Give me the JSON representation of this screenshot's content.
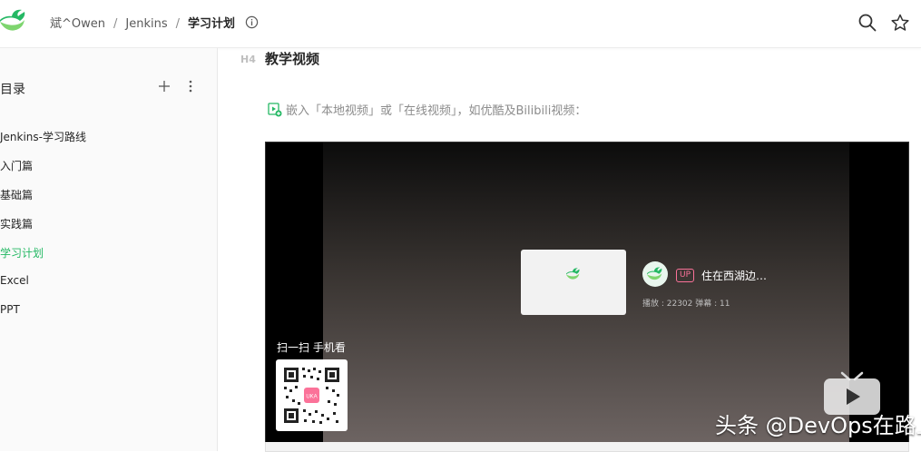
{
  "header": {
    "breadcrumb": [
      "斌^Owen",
      "Jenkins",
      "学习计划"
    ],
    "separator": "/"
  },
  "sidebar": {
    "title": "目录",
    "items": [
      {
        "label": "Jenkins-学习路线"
      },
      {
        "label": "入门篇"
      },
      {
        "label": "基础篇"
      },
      {
        "label": "实践篇"
      },
      {
        "label": "学习计划",
        "active": true
      },
      {
        "label": "Excel"
      },
      {
        "label": "PPT"
      }
    ]
  },
  "content": {
    "heading_marker": "H4",
    "heading": "教学视频",
    "embed_note": "嵌入「本地视频」或「在线视频」，如优酷及Bilibili视频："
  },
  "video": {
    "up_badge": "UP",
    "up_name": "住在西湖边…",
    "stats": "播放 : 22302     弹幕 : 11",
    "qr_title": "扫一扫 手机看",
    "qr_badge": "UKA",
    "watermark": "头条 @DevOps在路上"
  },
  "colors": {
    "accent": "#25b864",
    "bilibili_pink": "#fb7299"
  },
  "icons": [
    "logo-icon",
    "info-icon",
    "search-icon",
    "star-icon",
    "add-icon",
    "more-icon",
    "video-embed-icon",
    "play-icon",
    "qr-code-icon"
  ]
}
